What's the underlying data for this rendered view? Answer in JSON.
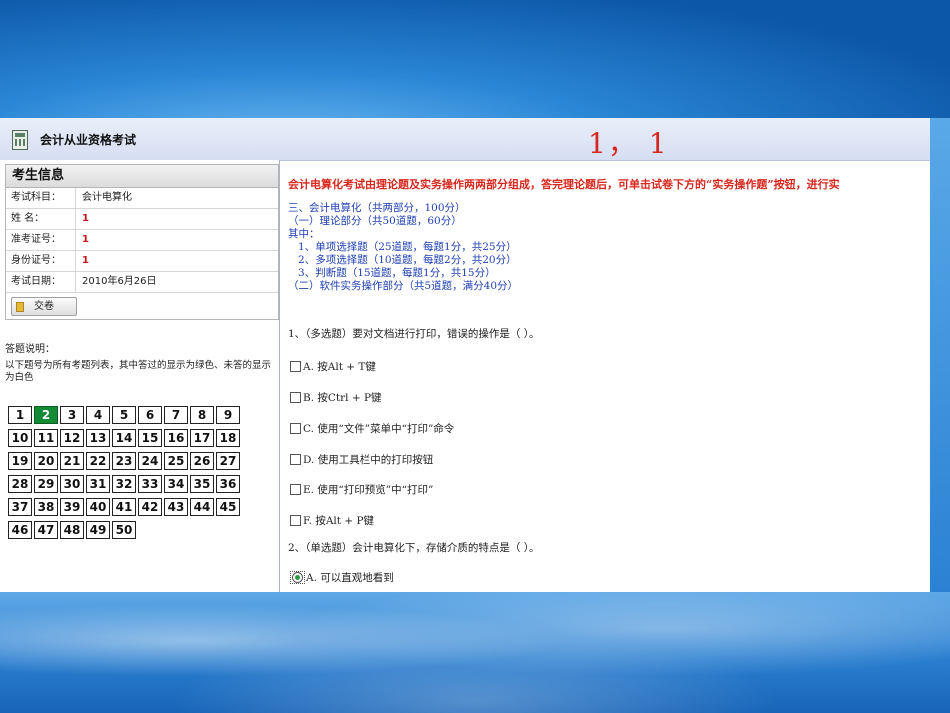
{
  "app": {
    "title": "会计从业资格考试",
    "header_number": "1，  1"
  },
  "candidate": {
    "heading": "考生信息",
    "rows": [
      {
        "label": "考试科目：",
        "value": "会计电算化"
      },
      {
        "label": "姓  名：",
        "value": "1"
      },
      {
        "label": "准考证号：",
        "value": "1"
      },
      {
        "label": "身份证号：",
        "value": "1"
      },
      {
        "label": "考试日期：",
        "value": "2010年6月26日"
      }
    ],
    "submit_label": "交卷"
  },
  "instructions": {
    "title": "答题说明：",
    "text": "以下题号为所有考题列表，其中答过的显示为绿色、未答的显示为白色"
  },
  "question_grid": {
    "numbers": [
      "1",
      "2",
      "3",
      "4",
      "5",
      "6",
      "7",
      "8",
      "9",
      "10",
      "11",
      "12",
      "13",
      "14",
      "15",
      "16",
      "17",
      "18",
      "19",
      "20",
      "21",
      "22",
      "23",
      "24",
      "25",
      "26",
      "27",
      "28",
      "29",
      "30",
      "31",
      "32",
      "33",
      "34",
      "35",
      "36",
      "37",
      "38",
      "39",
      "40",
      "41",
      "42",
      "43",
      "44",
      "45",
      "46",
      "47",
      "48",
      "49",
      "50"
    ],
    "answered": [
      "2"
    ],
    "answered_color": "#138a34"
  },
  "main": {
    "notice": "会计电算化考试由理论题及实务操作两两部分组成，答完理论题后，可单击试卷下方的“实务操作题”按钮，进行实",
    "score_lines": [
      "三、会计电算化（共两部分，100分）",
      "（一）理论部分（共50道题，60分）",
      "其中：",
      "   1、单项选择题（25道题，每题1分，共25分）",
      "   2、多项选择题（10道题，每题2分，共20分）",
      "   3、判断题（15道题，每题1分，共15分）",
      "（二）软件实务操作部分（共5道题，满分40分）"
    ],
    "q1": {
      "stem": "1、（多选题）要对文档进行打印，错误的操作是（ ）。",
      "options": [
        "A. 按Alt + T键",
        "B. 按Ctrl + P键",
        "C. 使用“文件”菜单中“打印”命令",
        "D. 使用工具栏中的打印按钮",
        "E. 使用“打印预览”中“打印”",
        "F. 按Alt + P键"
      ]
    },
    "q2": {
      "stem": "2、（单选题）会计电算化下，存储介质的特点是（ ）。",
      "options": [
        "A. 可以直观地看到"
      ],
      "selected": "A"
    }
  }
}
